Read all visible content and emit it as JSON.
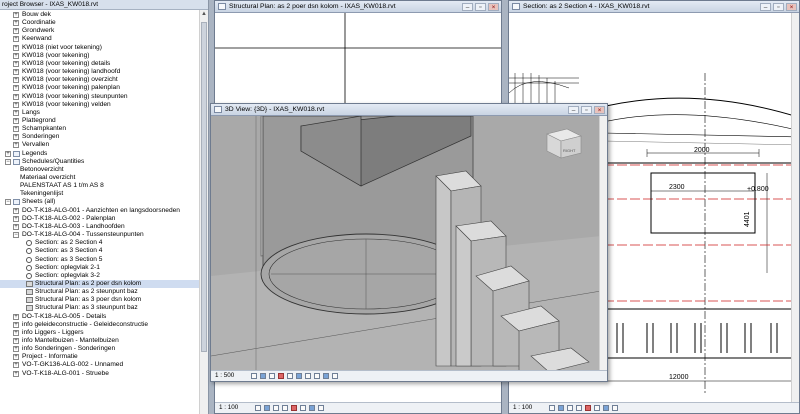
{
  "project_browser": {
    "title": "roject Browser - IXAS_KW018.rvt",
    "items": [
      {
        "label": "Bouw dek",
        "level": 1,
        "icon": "plus"
      },
      {
        "label": "Coordinatie",
        "level": 1,
        "icon": "plus"
      },
      {
        "label": "Grondwerk",
        "level": 1,
        "icon": "plus"
      },
      {
        "label": "Keerwand",
        "level": 1,
        "icon": "plus"
      },
      {
        "label": "KW018 (niet voor tekening)",
        "level": 1,
        "icon": "plus"
      },
      {
        "label": "KW018 (voor tekening)",
        "level": 1,
        "icon": "plus"
      },
      {
        "label": "KW018 (voor tekening) details",
        "level": 1,
        "icon": "plus"
      },
      {
        "label": "KW018 (voor tekening) landhoofd",
        "level": 1,
        "icon": "plus"
      },
      {
        "label": "KW018 (voor tekening) overzicht",
        "level": 1,
        "icon": "plus"
      },
      {
        "label": "KW018 (voor tekening) palenplan",
        "level": 1,
        "icon": "plus"
      },
      {
        "label": "KW018 (voor tekening) steunpunten",
        "level": 1,
        "icon": "plus"
      },
      {
        "label": "KW018 (voor tekening) velden",
        "level": 1,
        "icon": "plus"
      },
      {
        "label": "Langs",
        "level": 1,
        "icon": "plus"
      },
      {
        "label": "Plattegrond",
        "level": 1,
        "icon": "plus"
      },
      {
        "label": "Schampkanten",
        "level": 1,
        "icon": "plus"
      },
      {
        "label": "Sonderingen",
        "level": 1,
        "icon": "plus"
      },
      {
        "label": "Vervallen",
        "level": 1,
        "icon": "plus"
      },
      {
        "label": "Legends",
        "level": 0,
        "icon": "plus",
        "folder": true
      },
      {
        "label": "Schedules/Quantities",
        "level": 0,
        "icon": "minus",
        "folder": true
      },
      {
        "label": "Betonoverzicht",
        "level": 1,
        "icon": "none"
      },
      {
        "label": "Materiaal overzicht",
        "level": 1,
        "icon": "none"
      },
      {
        "label": "PALENSTAAT AS 1 t/m AS 8",
        "level": 1,
        "icon": "none"
      },
      {
        "label": "Tekeningenlijst",
        "level": 1,
        "icon": "none"
      },
      {
        "label": "Sheets (all)",
        "level": 0,
        "icon": "minus",
        "folder": true
      },
      {
        "label": "DO-T-K18-ALG-001 - Aanzichten en langsdoorsneden",
        "level": 1,
        "icon": "plus"
      },
      {
        "label": "DO-T-K18-ALG-002 - Palenplan",
        "level": 1,
        "icon": "plus"
      },
      {
        "label": "DO-T-K18-ALG-003 - Landhoofden",
        "level": 1,
        "icon": "plus"
      },
      {
        "label": "DO-T-K18-ALG-004 - Tussensteunpunten",
        "level": 1,
        "icon": "minus"
      },
      {
        "label": "Section: as 2 Section 4",
        "level": 2,
        "icon": "sec"
      },
      {
        "label": "Section: as 3 Section 4",
        "level": 2,
        "icon": "sec"
      },
      {
        "label": "Section: as 3 Section 5",
        "level": 2,
        "icon": "sec"
      },
      {
        "label": "Section: oplegvlak 2-1",
        "level": 2,
        "icon": "sec"
      },
      {
        "label": "Section: oplegvlak 3-2",
        "level": 2,
        "icon": "sec"
      },
      {
        "label": "Structural Plan: as 2 poer dsn kolom",
        "level": 2,
        "icon": "plan",
        "selected": true
      },
      {
        "label": "Structural Plan: as 2 steunpunt baz",
        "level": 2,
        "icon": "plan"
      },
      {
        "label": "Structural Plan: as 3 poer dsn kolom",
        "level": 2,
        "icon": "plan"
      },
      {
        "label": "Structural Plan: as 3 steunpunt baz",
        "level": 2,
        "icon": "plan"
      },
      {
        "label": "DO-T-K18-ALG-005 - Details",
        "level": 1,
        "icon": "plus"
      },
      {
        "label": "info      geleideconstructie - Geleideconstructie",
        "level": 1,
        "icon": "plus"
      },
      {
        "label": "info      Liggers - Liggers",
        "level": 1,
        "icon": "plus"
      },
      {
        "label": "info      Mantelbuizen - Mantelbuizen",
        "level": 1,
        "icon": "plus"
      },
      {
        "label": "info      Sonderingen - Sonderingen",
        "level": 1,
        "icon": "plus"
      },
      {
        "label": "Project - Informatie",
        "level": 1,
        "icon": "plus"
      },
      {
        "label": "VO-T-GK136-ALG-002 - Unnamed",
        "level": 1,
        "icon": "plus"
      },
      {
        "label": "VO-T-K18-ALG-001 - Struebe",
        "level": 1,
        "icon": "plus"
      }
    ]
  },
  "views": {
    "structural_plan": {
      "title": "Structural Plan: as 2 poer dsn kolom - IXAS_KW018.rvt",
      "scale": "1 : 100"
    },
    "section": {
      "title": "Section: as 2 Section 4 - IXAS_KW018.rvt",
      "scale": "1 : 100",
      "dims": {
        "d1": "2000",
        "d2": "2300",
        "elev": "+0.800",
        "vert": "4401",
        "bottom": "12000"
      }
    },
    "view_3d": {
      "title": "3D View: {3D} - IXAS_KW018.rvt",
      "scale": "1 : 500",
      "cube_label": "RIGHT"
    }
  },
  "colors": {
    "accent_red": "#cc1f1f",
    "titlebar": "#d7e0ec"
  }
}
